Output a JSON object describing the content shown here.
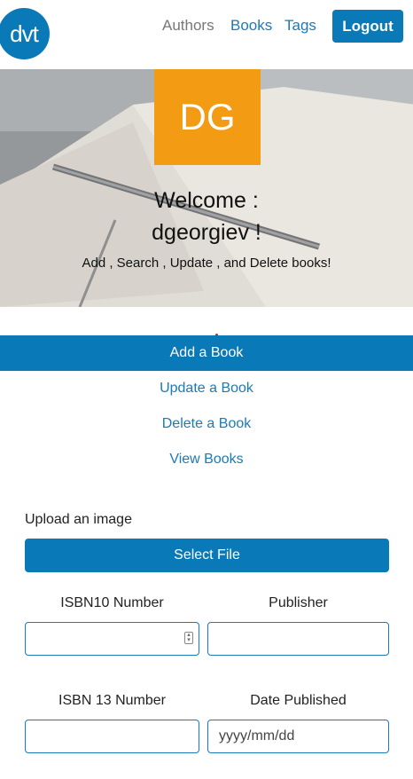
{
  "header": {
    "logo_text": "dvt",
    "nav": {
      "authors": "Authors",
      "books": "Books",
      "tags": "Tags"
    },
    "logout_label": "Logout"
  },
  "hero": {
    "avatar_initials": "DG",
    "welcome_line1": "Welcome :",
    "welcome_line2": "dgeorgiev !",
    "subtitle": "Add , Search , Update , and Delete books!"
  },
  "menu": {
    "items": [
      {
        "label": "Add a Book",
        "active": true
      },
      {
        "label": "Update a Book",
        "active": false
      },
      {
        "label": "Delete a Book",
        "active": false
      },
      {
        "label": "View Books",
        "active": false
      }
    ]
  },
  "form": {
    "upload_label": "Upload an image",
    "select_file_label": "Select File",
    "isbn10_label": "ISBN10 Number",
    "publisher_label": "Publisher",
    "isbn13_label": "ISBN 13 Number",
    "date_published_label": "Date Published",
    "date_placeholder": "yyyy/mm/dd"
  },
  "colors": {
    "brand_blue": "#0a79b8",
    "avatar_orange": "#f29b13"
  }
}
